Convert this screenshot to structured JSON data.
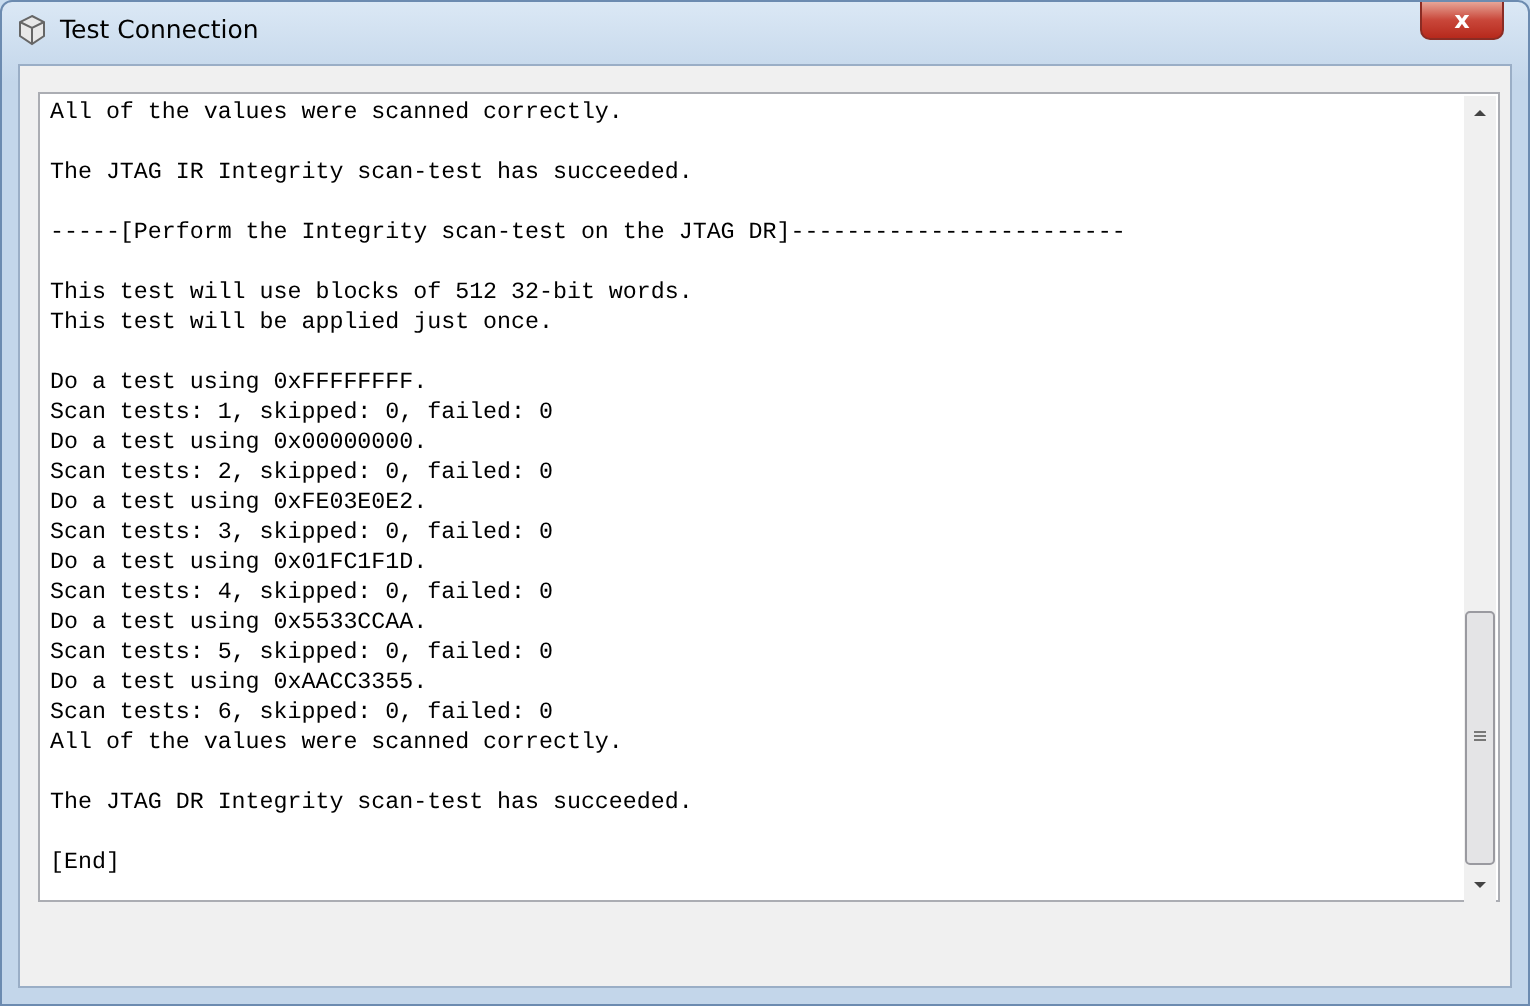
{
  "window": {
    "title": "Test Connection",
    "close_label": "x"
  },
  "log": {
    "paragraphs": [
      [
        "All of the values were scanned correctly."
      ],
      [
        "The JTAG IR Integrity scan-test has succeeded."
      ],
      [
        "-----[Perform the Integrity scan-test on the JTAG DR]------------------------"
      ],
      [
        "This test will use blocks of 512 32-bit words.",
        "This test will be applied just once."
      ],
      [
        "Do a test using 0xFFFFFFFF.",
        "Scan tests: 1, skipped: 0, failed: 0",
        "Do a test using 0x00000000.",
        "Scan tests: 2, skipped: 0, failed: 0",
        "Do a test using 0xFE03E0E2.",
        "Scan tests: 3, skipped: 0, failed: 0",
        "Do a test using 0x01FC1F1D.",
        "Scan tests: 4, skipped: 0, failed: 0",
        "Do a test using 0x5533CCAA.",
        "Scan tests: 5, skipped: 0, failed: 0",
        "Do a test using 0xAACC3355.",
        "Scan tests: 6, skipped: 0, failed: 0",
        "All of the values were scanned correctly."
      ],
      [
        "The JTAG DR Integrity scan-test has succeeded."
      ],
      [
        "[End]"
      ]
    ]
  }
}
